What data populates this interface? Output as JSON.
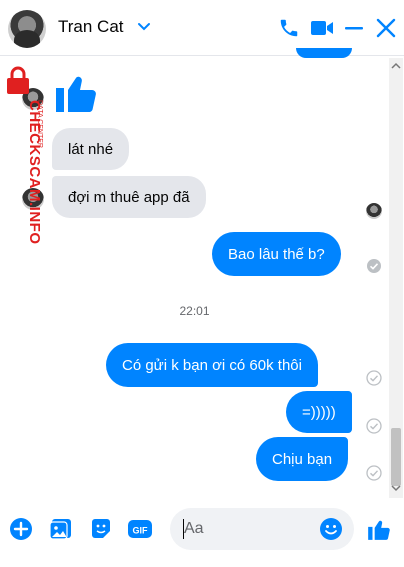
{
  "header": {
    "contact_name": "Tran Cat",
    "accent": "#0084ff"
  },
  "messages": [
    {
      "from": "them",
      "text": "lát nhé"
    },
    {
      "from": "them",
      "text": "đợi m thuê app đã"
    },
    {
      "from": "me",
      "text": "Bao lâu thế b?"
    },
    {
      "from": "me",
      "text": "Có gửi k bạn ơi có 60k thôi"
    },
    {
      "from": "me",
      "text": "=)))))"
    },
    {
      "from": "me",
      "text": "Chịu bạn"
    }
  ],
  "timestamp": "22:01",
  "watermark": {
    "text": "CHECKSCAM.INFO",
    "subtext": "DATA CENTER"
  },
  "composer": {
    "placeholder": "Aa"
  },
  "icons": [
    "phone-icon",
    "video-icon",
    "minimize-icon",
    "close-icon",
    "plus-icon",
    "image-icon",
    "sticker-icon",
    "gif-icon",
    "emoji-icon",
    "like-icon"
  ]
}
